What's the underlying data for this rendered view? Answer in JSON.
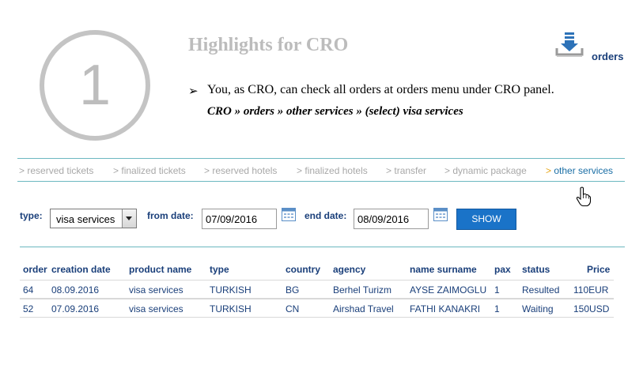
{
  "header": {
    "step_number": "1",
    "title": "Highlights for CRO",
    "bullet": "You, as CRO, can check all orders at orders menu under CRO panel.",
    "path": "CRO » orders » other services » (select) visa services",
    "orders_link": "orders",
    "orders_icon": "download-tray-icon"
  },
  "tabs": [
    {
      "label": "reserved tickets",
      "active": false
    },
    {
      "label": "finalized tickets",
      "active": false
    },
    {
      "label": "reserved hotels",
      "active": false
    },
    {
      "label": "finalized hotels",
      "active": false
    },
    {
      "label": "transfer",
      "active": false
    },
    {
      "label": "dynamic package",
      "active": false
    },
    {
      "label": "other services",
      "active": true
    }
  ],
  "tab_prefix": ">",
  "filters": {
    "type_label": "type:",
    "type_value": "visa services",
    "from_label": "from date:",
    "from_value": "07/09/2016",
    "end_label": "end date:",
    "end_value": "08/09/2016",
    "show_label": "SHOW"
  },
  "table": {
    "columns": [
      "order",
      "creation date",
      "product name",
      "type",
      "country",
      "agency",
      "name surname",
      "pax",
      "status",
      "Price"
    ],
    "rows": [
      [
        "64",
        "08.09.2016",
        "visa services",
        "TURKISH",
        "BG",
        "Berhel Turizm",
        "AYSE ZAIMOGLU",
        "1",
        "Resulted",
        "110EUR"
      ],
      [
        "52",
        "07.09.2016",
        "visa services",
        "TURKISH",
        "CN",
        "Airshad Travel",
        "FATHI KANAKRI",
        "1",
        "Waiting",
        "150USD"
      ]
    ]
  },
  "colors": {
    "accent_blue": "#1a73c8",
    "link_navy": "#1a3f7a",
    "active_tab": "#1a6ea5",
    "active_marker": "#e6a517",
    "divider_teal": "#6cb8c0"
  }
}
